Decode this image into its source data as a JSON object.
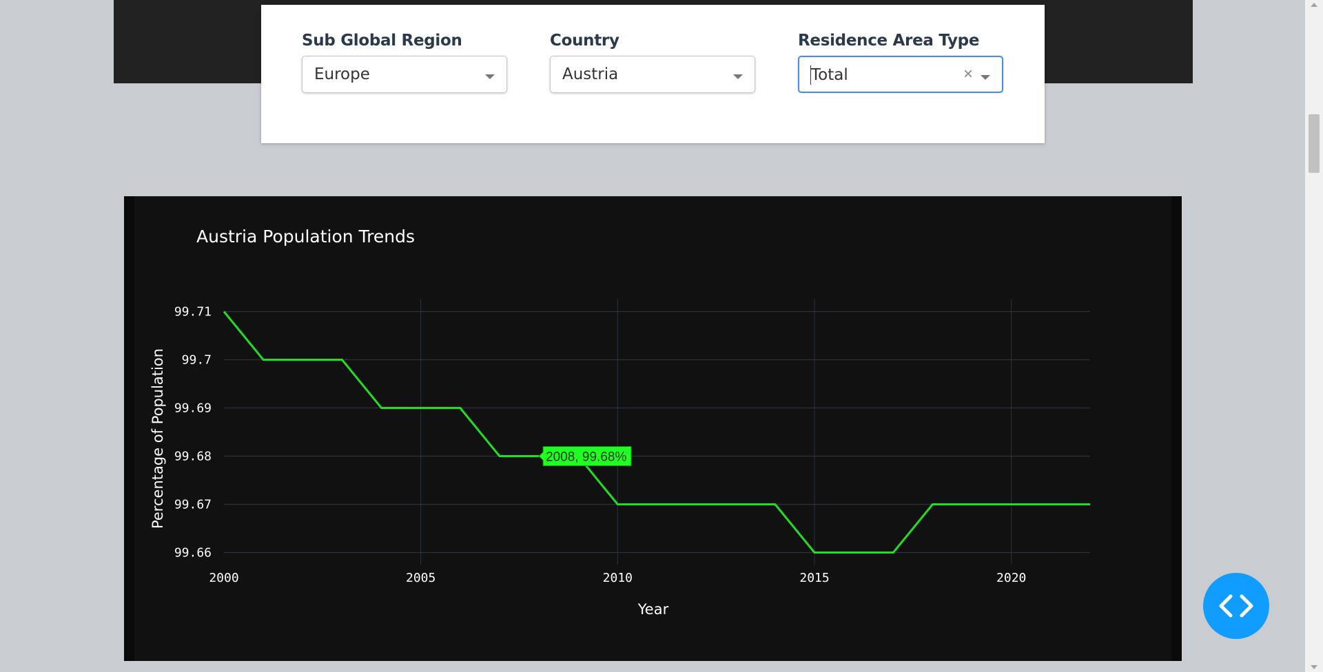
{
  "filters": [
    {
      "label": "Sub Global Region",
      "value": "Europe"
    },
    {
      "label": "Country",
      "value": "Austria"
    },
    {
      "label": "Residence Area Type",
      "value": "Total"
    }
  ],
  "colors": {
    "line": "#22dd22",
    "grid": "#2a3340",
    "accent": "#119dff"
  },
  "tooltip": {
    "text": "2008, 99.68%"
  },
  "chart_data": {
    "type": "line",
    "title": "Austria Population Trends",
    "xlabel": "Year",
    "ylabel": "Percentage of Population",
    "x": [
      2000,
      2001,
      2002,
      2003,
      2004,
      2005,
      2006,
      2007,
      2008,
      2009,
      2010,
      2011,
      2012,
      2013,
      2014,
      2015,
      2016,
      2017,
      2018,
      2019,
      2020,
      2021,
      2022
    ],
    "series": [
      {
        "values": [
          99.71,
          99.7,
          99.7,
          99.7,
          99.69,
          99.69,
          99.69,
          99.68,
          99.68,
          99.68,
          99.67,
          99.67,
          99.67,
          99.67,
          99.67,
          99.66,
          99.66,
          99.66,
          99.67,
          99.67,
          99.67,
          99.67,
          99.67
        ]
      }
    ],
    "xticks": [
      "2000",
      "2005",
      "2010",
      "2015",
      "2020"
    ],
    "yticks": [
      "99.71",
      "99.7",
      "99.69",
      "99.68",
      "99.67",
      "99.66"
    ],
    "xlim": [
      2000,
      2022
    ],
    "ylim": [
      99.6575,
      99.7125
    ],
    "grid": true,
    "highlight_x": 2008
  },
  "fab": {
    "icon": "code-icon"
  }
}
